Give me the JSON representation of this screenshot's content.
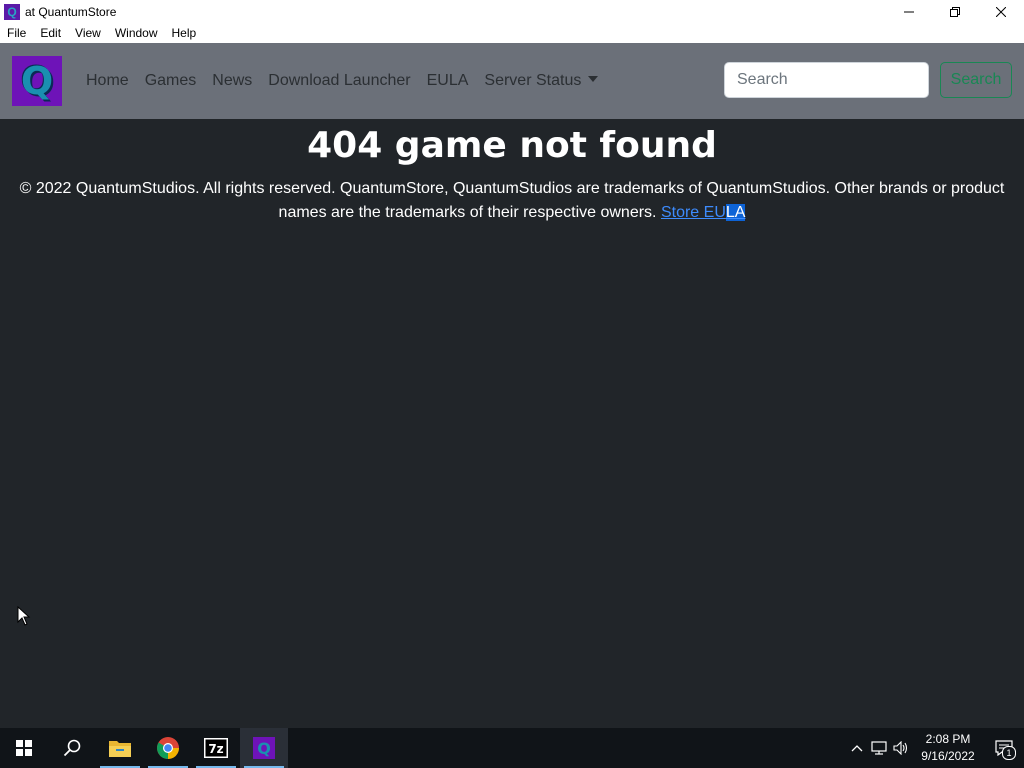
{
  "window": {
    "title": "at QuantumStore",
    "app_icon_letter": "Q"
  },
  "menu": {
    "items": [
      "File",
      "Edit",
      "View",
      "Window",
      "Help"
    ]
  },
  "navbar": {
    "brand_letter": "Q",
    "links": [
      "Home",
      "Games",
      "News",
      "Download Launcher",
      "EULA",
      "Server Status"
    ],
    "search_placeholder": "Search",
    "search_button": "Search"
  },
  "main": {
    "title": "404 game not found",
    "footer_text": "© 2022 QuantumStudios. All rights reserved. QuantumStore, QuantumStudios are trademarks of QuantumStudios. Other brands or product names are the trademarks of their respective owners.",
    "link_text_unselected": "Store EU",
    "link_text_selected": "LA"
  },
  "taskbar": {
    "apps": [
      "start-icon",
      "search-icon",
      "file-explorer-icon",
      "chrome-icon",
      "7zip-icon",
      "quantumstore-icon"
    ],
    "sevenzip_label": "7z",
    "time": "2:08 PM",
    "date": "9/16/2022",
    "notification_count": "1"
  },
  "colors": {
    "page_background": "#212529",
    "navbar_background": "#6b7079",
    "link": "#3d8bfd",
    "search_button": "#198754",
    "brand_background": "#6e13b8"
  }
}
